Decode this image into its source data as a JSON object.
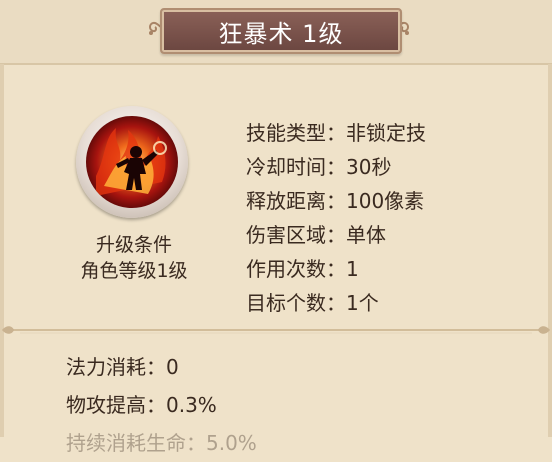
{
  "title": "狂暴术 1级",
  "skill": {
    "icon": "fire-berserker-icon",
    "upgrade_label": "升级条件",
    "upgrade_requirement": "角色等级1级"
  },
  "stats": [
    {
      "label": "技能类型：",
      "value": "非锁定技"
    },
    {
      "label": "冷却时间：",
      "value": "30秒"
    },
    {
      "label": "释放距离：",
      "value": "100像素"
    },
    {
      "label": "伤害区域：",
      "value": "单体"
    },
    {
      "label": "作用次数：",
      "value": "1"
    },
    {
      "label": "目标个数：",
      "value": "1个"
    }
  ],
  "effects": [
    {
      "label": "法力消耗：",
      "value": "0"
    },
    {
      "label": "物攻提高：",
      "value": "0.3%"
    },
    {
      "label": "持续消耗生命：",
      "value": "5.0%"
    }
  ],
  "colors": {
    "panel_bg": "#efe2c9",
    "banner": "#7a5249",
    "text": "#3a2a20"
  }
}
